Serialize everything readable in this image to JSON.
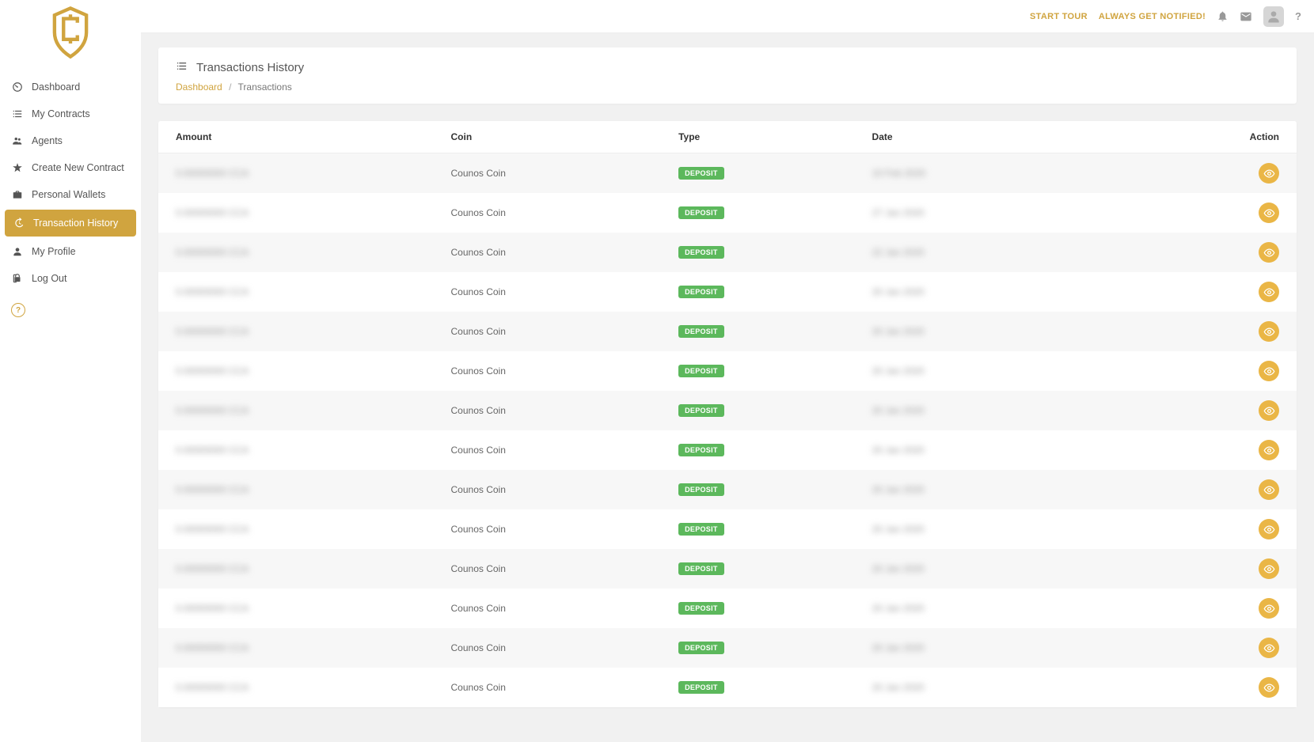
{
  "topbar": {
    "start_tour": "START TOUR",
    "notified": "ALWAYS GET NOTIFIED!"
  },
  "sidebar": {
    "items": [
      {
        "label": "Dashboard",
        "icon": "dashboard-icon"
      },
      {
        "label": "My Contracts",
        "icon": "list-icon"
      },
      {
        "label": "Agents",
        "icon": "users-icon"
      },
      {
        "label": "Create New Contract",
        "icon": "star-icon"
      },
      {
        "label": "Personal Wallets",
        "icon": "briefcase-icon"
      },
      {
        "label": "Transaction History",
        "icon": "history-icon"
      },
      {
        "label": "My Profile",
        "icon": "user-icon"
      },
      {
        "label": "Log Out",
        "icon": "logout-icon"
      }
    ],
    "active_index": 5
  },
  "header": {
    "title": "Transactions History",
    "breadcrumb": {
      "link": "Dashboard",
      "current": "Transactions"
    }
  },
  "table": {
    "headers": {
      "amount": "Amount",
      "coin": "Coin",
      "type": "Type",
      "date": "Date",
      "action": "Action"
    },
    "rows": [
      {
        "amount": "0.00000000 CCA",
        "coin": "Counos Coin",
        "type": "DEPOSIT",
        "date": "10 Feb 2020"
      },
      {
        "amount": "0.00000000 CCA",
        "coin": "Counos Coin",
        "type": "DEPOSIT",
        "date": "27 Jan 2020"
      },
      {
        "amount": "0.00000000 CCA",
        "coin": "Counos Coin",
        "type": "DEPOSIT",
        "date": "22 Jan 2020"
      },
      {
        "amount": "0.00000000 CCA",
        "coin": "Counos Coin",
        "type": "DEPOSIT",
        "date": "20 Jan 2020"
      },
      {
        "amount": "0.00000000 CCA",
        "coin": "Counos Coin",
        "type": "DEPOSIT",
        "date": "20 Jan 2020"
      },
      {
        "amount": "0.00000000 CCA",
        "coin": "Counos Coin",
        "type": "DEPOSIT",
        "date": "20 Jan 2020"
      },
      {
        "amount": "0.00000000 CCA",
        "coin": "Counos Coin",
        "type": "DEPOSIT",
        "date": "20 Jan 2020"
      },
      {
        "amount": "0.00000000 CCA",
        "coin": "Counos Coin",
        "type": "DEPOSIT",
        "date": "20 Jan 2020"
      },
      {
        "amount": "0.00000000 CCA",
        "coin": "Counos Coin",
        "type": "DEPOSIT",
        "date": "20 Jan 2020"
      },
      {
        "amount": "0.00000000 CCA",
        "coin": "Counos Coin",
        "type": "DEPOSIT",
        "date": "20 Jan 2020"
      },
      {
        "amount": "0.00000000 CCA",
        "coin": "Counos Coin",
        "type": "DEPOSIT",
        "date": "20 Jan 2020"
      },
      {
        "amount": "0.00000000 CCA",
        "coin": "Counos Coin",
        "type": "DEPOSIT",
        "date": "20 Jan 2020"
      },
      {
        "amount": "0.00000000 CCA",
        "coin": "Counos Coin",
        "type": "DEPOSIT",
        "date": "20 Jan 2020"
      },
      {
        "amount": "0.00000000 CCA",
        "coin": "Counos Coin",
        "type": "DEPOSIT",
        "date": "20 Jan 2020"
      }
    ]
  }
}
